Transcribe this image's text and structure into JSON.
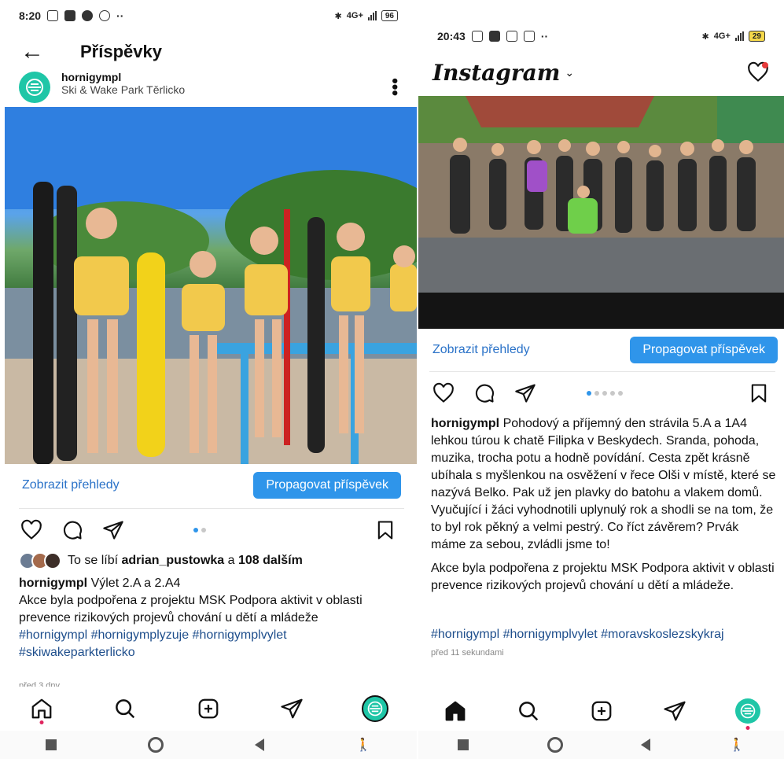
{
  "left": {
    "status": {
      "time": "8:20",
      "battery": "96",
      "network": "4G+"
    },
    "header": {
      "title": "Příspěvky"
    },
    "post": {
      "username": "hornigympl",
      "location": "Ski & Wake Park Těrlicko",
      "insights_label": "Zobrazit přehledy",
      "promote_label": "Propagovat příspěvek",
      "likes_prefix": "To se líbí",
      "likes_user": "adrian_pustowka",
      "likes_and": "a",
      "likes_more": "108 dalším",
      "caption_user": "hornigympl",
      "caption_title": "Výlet 2.A a 2.A4",
      "caption_body": "Akce byla podpořena z projektu MSK Podpora aktivit v oblasti prevence rizikových projevů chování u dětí a mládeže",
      "hashtags": "#hornigympl #hornigymplyzuje #hornigymplvylet #skiwakeparkterlicko",
      "timestamp": "před 3 dny"
    }
  },
  "right": {
    "status": {
      "time": "20:43",
      "battery": "29",
      "network": "4G+"
    },
    "header": {
      "logo": "Instagram"
    },
    "post": {
      "insights_label": "Zobrazit přehledy",
      "promote_label": "Propagovat příspěvek",
      "caption_user": "hornigympl",
      "caption_body": "Pohodový a příjemný den strávila 5.A a 1A4 lehkou túrou k chatě Filipka v Beskydech. Sranda, pohoda, muzika, trocha potu a hodně povídání. Cesta zpět krásně ubíhala s myšlenkou na osvěžení v řece Olši v místě, které se nazývá Belko. Pak už jen plavky do batohu a vlakem domů. Vyučující i žáci vyhodnotili uplynulý rok a shodli se na tom, že to byl rok pěkný a velmi pestrý. Co říct závěrem? Prvák máme za sebou, zvládli jsme to!",
      "caption_support": "Akce byla podpořena z projektu MSK Podpora aktivit v oblasti prevence rizikových projevů chování u dětí a mládeže.",
      "hashtags": "#hornigympl #hornigymplvylet #moravskoslezskykraj",
      "timestamp": "před 11 sekundami"
    }
  },
  "colors": {
    "accent": "#2f95ea",
    "link": "#2a72c8",
    "hashtag": "#1e4e8c",
    "brand_teal": "#1fc6a7"
  }
}
